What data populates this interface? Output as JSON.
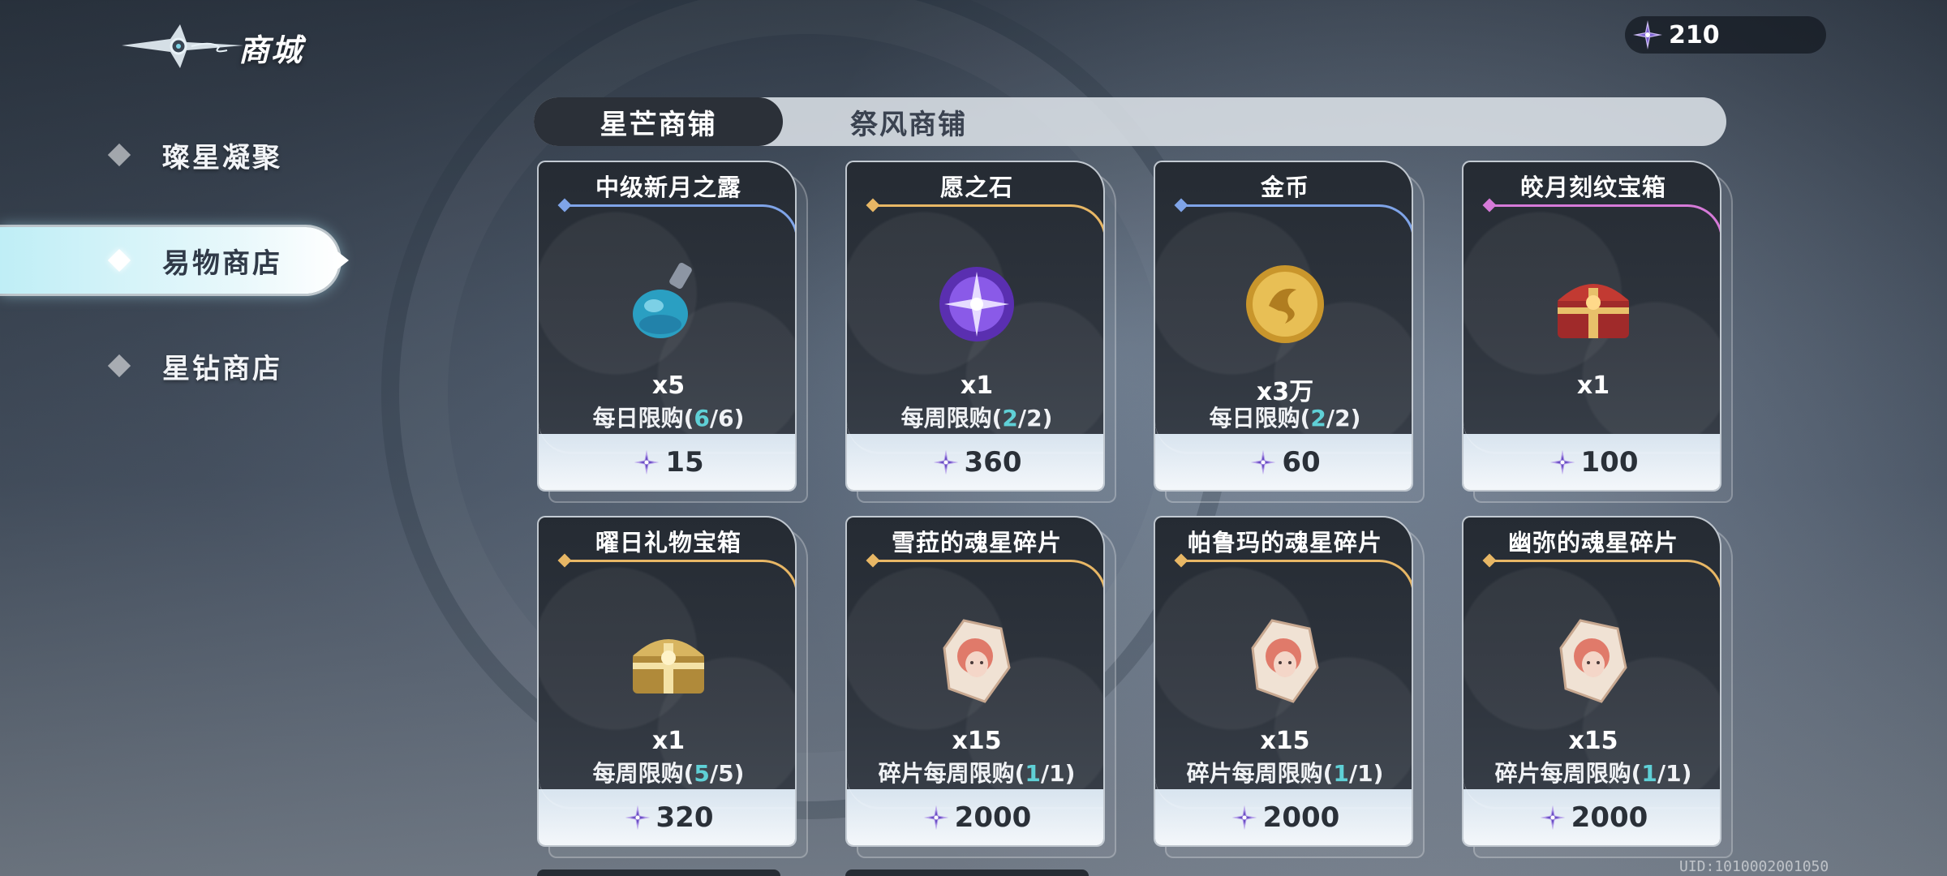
{
  "header": {
    "title": "商城"
  },
  "currency": {
    "value": "210",
    "icon": "star-crystal-icon"
  },
  "sidebar": {
    "items": [
      {
        "label": "璨星凝聚",
        "active": false
      },
      {
        "label": "易物商店",
        "active": true
      },
      {
        "label": "星钻商店",
        "active": false
      }
    ]
  },
  "tabs": [
    {
      "label": "星芒商铺",
      "active": true
    },
    {
      "label": "祭风商铺",
      "active": false
    }
  ],
  "items": [
    {
      "name": "中级新月之露",
      "qty": "x5",
      "limit_prefix": "每日限购(",
      "limit_current": "6",
      "limit_suffix": "/6)",
      "price": "15",
      "accent": "#7fa4e8",
      "icon": "potion-bottle-icon"
    },
    {
      "name": "愿之石",
      "qty": "x1",
      "limit_prefix": "每周限购(",
      "limit_current": "2",
      "limit_suffix": "/2)",
      "price": "360",
      "accent": "#e8b765",
      "icon": "wish-stone-icon"
    },
    {
      "name": "金币",
      "qty": "x3万",
      "limit_prefix": "每日限购(",
      "limit_current": "2",
      "limit_suffix": "/2)",
      "price": "60",
      "accent": "#7fa4e8",
      "icon": "gold-coin-icon"
    },
    {
      "name": "皎月刻纹宝箱",
      "qty": "x1",
      "limit_prefix": "",
      "limit_current": "",
      "limit_suffix": "",
      "price": "100",
      "accent": "#d67ad8",
      "icon": "red-chest-icon"
    },
    {
      "name": "曜日礼物宝箱",
      "qty": "x1",
      "limit_prefix": "每周限购(",
      "limit_current": "5",
      "limit_suffix": "/5)",
      "price": "320",
      "accent": "#e8b765",
      "icon": "gold-chest-icon"
    },
    {
      "name": "雪菈的魂星碎片",
      "qty": "x15",
      "limit_prefix": "碎片每周限购(",
      "limit_current": "1",
      "limit_suffix": "/1)",
      "price": "2000",
      "accent": "#e8b765",
      "icon": "soul-star-shard-icon"
    },
    {
      "name": "帕鲁玛的魂星碎片",
      "qty": "x15",
      "limit_prefix": "碎片每周限购(",
      "limit_current": "1",
      "limit_suffix": "/1)",
      "price": "2000",
      "accent": "#e8b765",
      "icon": "soul-star-shard-icon"
    },
    {
      "name": "幽弥的魂星碎片",
      "qty": "x15",
      "limit_prefix": "碎片每周限购(",
      "limit_current": "1",
      "limit_suffix": "/1)",
      "price": "2000",
      "accent": "#e8b765",
      "icon": "soul-star-shard-icon"
    }
  ],
  "uid": "UID:1010002001050"
}
